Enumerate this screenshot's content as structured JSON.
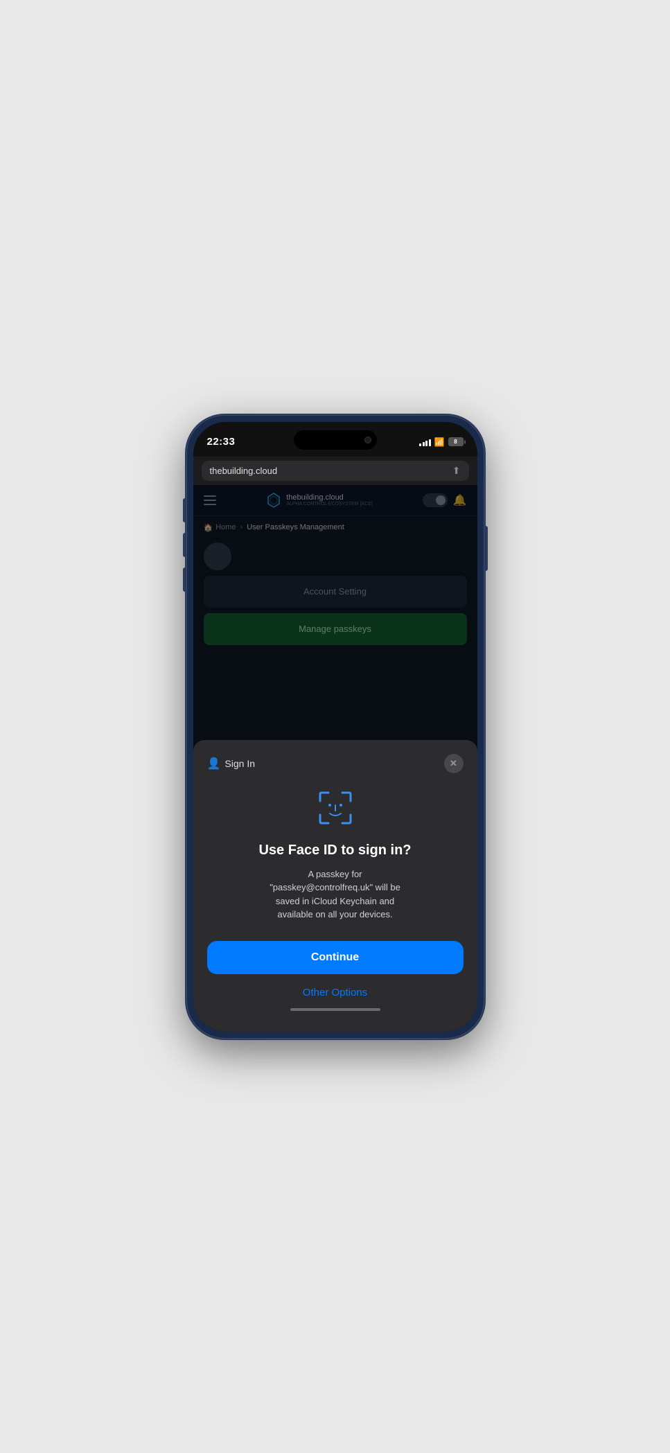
{
  "phone": {
    "status_bar": {
      "time": "22:33",
      "battery_level": "8"
    },
    "browser": {
      "url": "thebuilding.cloud",
      "share_icon": "↑"
    },
    "web": {
      "header": {
        "logo_text": "thebuilding.cloud",
        "logo_subtext": "ALPHA CONTROL ECOSYSTEM [ACE]"
      },
      "breadcrumb": {
        "home": "Home",
        "separator": "›",
        "current": "User Passkeys Management"
      },
      "account_setting_label": "Account Setting",
      "manage_passkeys_label": "Manage passkeys"
    },
    "bottom_sheet": {
      "sign_in_label": "Sign In",
      "close_icon": "✕",
      "title": "Use Face ID to sign in?",
      "description": "A passkey for\n\"passkey@controlfreq.uk\" will be\nsaved in iCloud Keychain and\navailable on all your devices.",
      "continue_label": "Continue",
      "other_options_label": "Other Options"
    }
  }
}
